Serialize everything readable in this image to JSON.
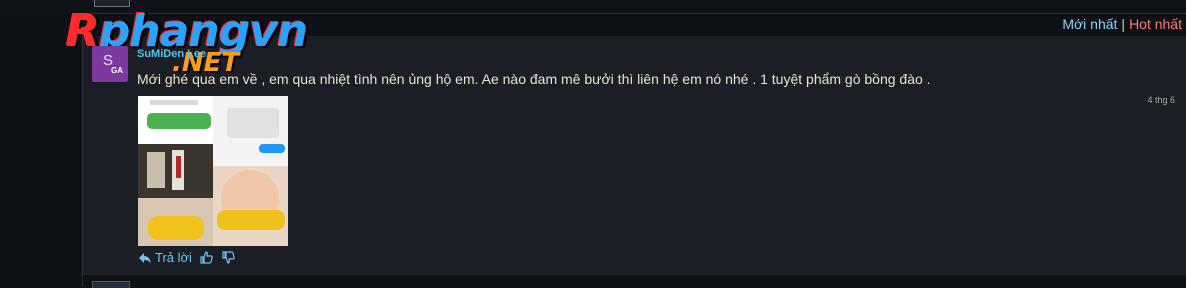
{
  "header": {
    "sort_newest": "Mới nhất",
    "sort_separator": "|",
    "sort_hot": "Hot nhất"
  },
  "logo": {
    "main_text_first": "R",
    "main_text_rest": "phangvn",
    "sub_text": ".NET"
  },
  "comment": {
    "avatar_letter": "S",
    "avatar_badge": "GA",
    "username": "SuMiDen Lee",
    "message": "Mới ghé qua em về , em qua nhiệt tình nên ủng hộ em. Ae nào đam mê bưởi thì liên hệ em nó nhé . 1 tuyệt phẩm gò bồng đào .",
    "time": "4 thg 6",
    "reply_label": "Trả lời"
  },
  "icons": {
    "reply": "reply-arrow-icon",
    "like": "thumbs-up-icon",
    "dislike": "thumbs-down-icon"
  },
  "colors": {
    "background": "#0e1116",
    "panel": "#1b1e25",
    "username": "#53c3ec",
    "newest": "#8fd3f0",
    "hot": "#ff7a6b",
    "action": "#6dc4ec",
    "avatar": "#7c3aa1"
  }
}
